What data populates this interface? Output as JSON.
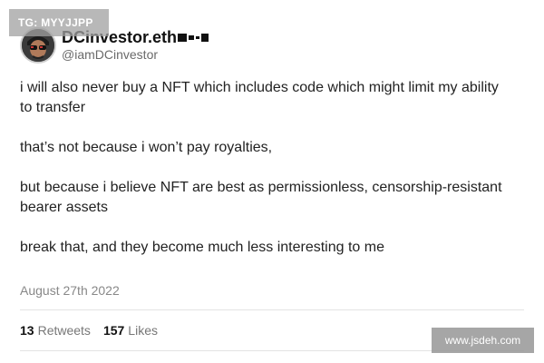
{
  "watermarks": {
    "top": "TG: MYYJJPP",
    "bottom": "www.jsdeh.com"
  },
  "author": {
    "display_name": "DCinvestor.eth",
    "handle": "@iamDCinvestor"
  },
  "tweet": {
    "paragraphs": [
      "i will also never buy a NFT which includes code which might limit my ability to transfer",
      "that’s not because i won’t pay royalties,",
      "but because i believe NFT are best as permissionless, censorship-resistant bearer assets",
      "break that, and they become much less interesting to me"
    ],
    "date": "August 27th 2022"
  },
  "stats": {
    "retweets_count": "13",
    "retweets_label": "Retweets",
    "likes_count": "157",
    "likes_label": "Likes"
  }
}
